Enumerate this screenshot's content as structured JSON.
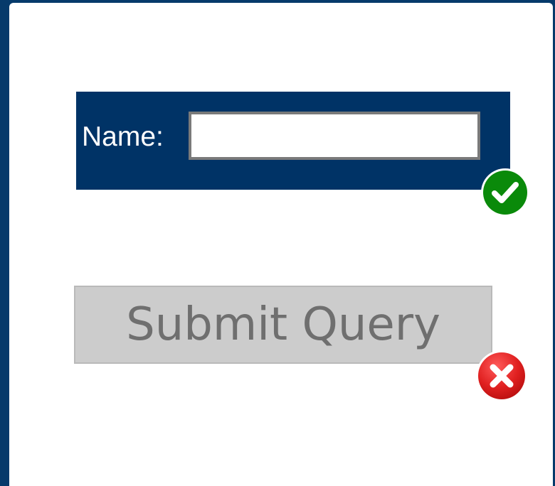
{
  "form": {
    "name_label": "Name:",
    "name_value": "",
    "name_placeholder": "",
    "submit_label": "Submit Query"
  },
  "status": {
    "name_field": "valid",
    "submit_button": "invalid"
  },
  "icons": {
    "name_status": "checkmark-icon",
    "submit_status": "error-x-icon"
  },
  "colors": {
    "page_border": "#063a6b",
    "panel_background": "#003366",
    "valid_green": "#0a8a0a",
    "invalid_red": "#e02020",
    "button_background": "#cccccc",
    "button_text": "#6f6f6f"
  }
}
